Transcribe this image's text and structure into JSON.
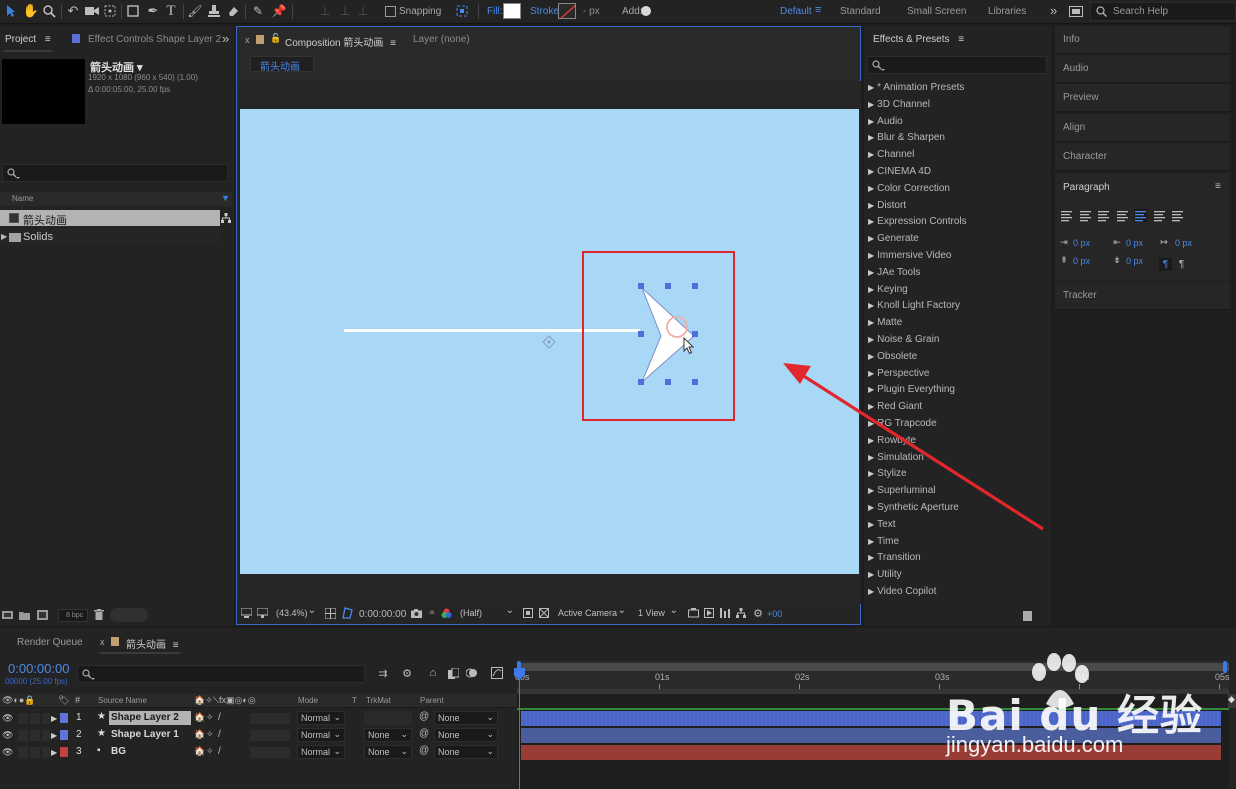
{
  "toolbar": {
    "snapping_label": "Snapping",
    "fill_label": "Fill:",
    "stroke_label": "Stroke:",
    "stroke_px": "- px",
    "add_label": "Add:",
    "workspaces": [
      "Default",
      "Standard",
      "Small Screen",
      "Libraries"
    ],
    "search_placeholder": "Search Help"
  },
  "project": {
    "tab_label": "Project",
    "effect_controls_tab": "Effect Controls Shape Layer 2",
    "comp_name": "箭头动画 ▾",
    "comp_res": "1920 x 1080  (960 x 540) (1.00)",
    "comp_dur": "Δ 0:00:05:00, 25.00 fps",
    "name_header": "Name",
    "items": [
      {
        "name": "箭头动画",
        "type": "comp"
      },
      {
        "name": "Solids",
        "type": "folder"
      }
    ],
    "bpc": "8 bpc"
  },
  "composition": {
    "tab_label": "Composition 箭头动画",
    "layer_tab": "Layer (none)",
    "breadcrumb": "箭头动画",
    "zoom": "(43.4%)",
    "timecode": "0:00:00:00",
    "resolution": "(Half)",
    "camera": "Active Camera",
    "views": "1 View",
    "exposure": "+00",
    "bg_color": "#a8d8f6"
  },
  "effects": {
    "title": "Effects & Presets",
    "items": [
      "* Animation Presets",
      "3D Channel",
      "Audio",
      "Blur & Sharpen",
      "Channel",
      "CINEMA 4D",
      "Color Correction",
      "Distort",
      "Expression Controls",
      "Generate",
      "Immersive Video",
      "JAe Tools",
      "Keying",
      "Knoll Light Factory",
      "Matte",
      "Noise & Grain",
      "Obsolete",
      "Perspective",
      "Plugin Everything",
      "Red Giant",
      "RG Trapcode",
      "Rowbyte",
      "Simulation",
      "Stylize",
      "Superluminal",
      "Synthetic Aperture",
      "Text",
      "Time",
      "Transition",
      "Utility",
      "Video Copilot"
    ]
  },
  "right_panels": {
    "items": [
      "Info",
      "Audio",
      "Preview",
      "Align",
      "Character"
    ],
    "paragraph_title": "Paragraph",
    "px_values": [
      "0 px",
      "0 px",
      "0 px",
      "0 px",
      "0 px"
    ],
    "tracker": "Tracker"
  },
  "timeline": {
    "render_queue_tab": "Render Queue",
    "comp_tab": "箭头动画",
    "timecode": "0:00:00:00",
    "fps": "00000 (25.00 fps)",
    "col_source": "Source Name",
    "col_mode": "Mode",
    "col_t": "T",
    "col_trkmat": "TrkMat",
    "col_parent": "Parent",
    "ruler": [
      "00s",
      "01s",
      "02s",
      "03s",
      "04s",
      "05s"
    ],
    "layers": [
      {
        "num": "1",
        "name": "Shape Layer 2",
        "mode": "Normal",
        "trkmat": "",
        "parent": "None",
        "label_color": "#5f74d6",
        "bar_color": "#4a63c8",
        "selected": true
      },
      {
        "num": "2",
        "name": "Shape Layer 1",
        "mode": "Normal",
        "trkmat": "None",
        "parent": "None",
        "label_color": "#5f74d6",
        "bar_color": "#4a5e9e",
        "selected": false
      },
      {
        "num": "3",
        "name": "BG",
        "mode": "Normal",
        "trkmat": "None",
        "parent": "None",
        "label_color": "#c7433a",
        "bar_color": "#9a3c36",
        "selected": false
      }
    ]
  },
  "watermark": {
    "brand": "Bai du 经验",
    "url": "jingyan.baidu.com"
  }
}
